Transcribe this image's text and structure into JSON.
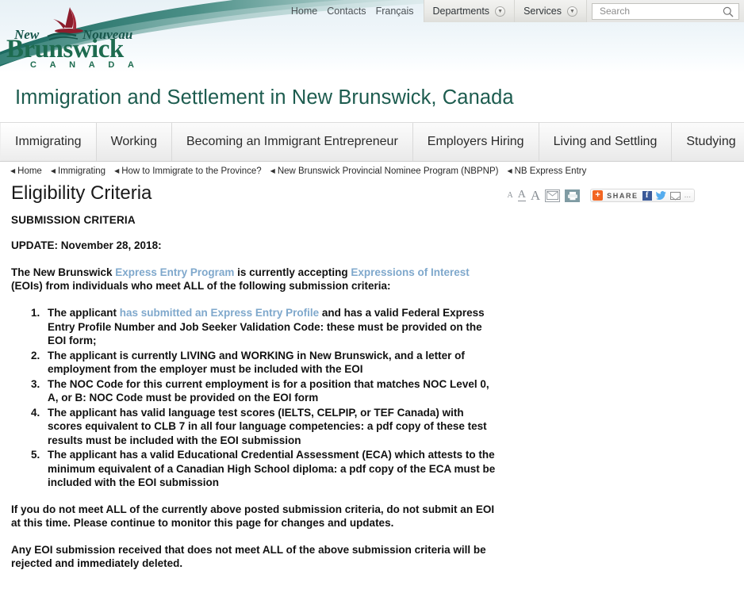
{
  "header": {
    "logo": {
      "line1_left": "New",
      "line1_right": "Nouveau",
      "wordmark": "Brunswick",
      "country": "C A N A D A"
    },
    "topnav": {
      "links": [
        {
          "label": "Home",
          "name": "topnav-home"
        },
        {
          "label": "Contacts",
          "name": "topnav-contacts"
        },
        {
          "label": "Français",
          "name": "topnav-francais"
        }
      ],
      "menus": [
        {
          "label": "Departments",
          "name": "topnav-departments"
        },
        {
          "label": "Services",
          "name": "topnav-services"
        }
      ],
      "search": {
        "placeholder": "Search",
        "value": "",
        "icon": "search-icon"
      }
    }
  },
  "banner": {
    "title": "Immigration and Settlement in New Brunswick, Canada",
    "color": "#1d5c4f"
  },
  "tabs": [
    {
      "label": "Immigrating",
      "active": true
    },
    {
      "label": "Working",
      "active": false
    },
    {
      "label": "Becoming an Immigrant Entrepreneur",
      "active": false
    },
    {
      "label": "Employers Hiring",
      "active": false
    },
    {
      "label": "Living and Settling",
      "active": false
    },
    {
      "label": "Studying",
      "active": false
    }
  ],
  "breadcrumb": [
    {
      "label": "Home"
    },
    {
      "label": "Immigrating"
    },
    {
      "label": "How to Immigrate to the Province?"
    },
    {
      "label": "New Brunswick Provincial Nominee Program (NBPNP)"
    },
    {
      "label": "NB Express Entry"
    }
  ],
  "toolbar": {
    "font_small": "A",
    "font_medium": "A",
    "font_large": "A",
    "email_icon": "envelope-icon",
    "print_icon": "printer-icon",
    "share": {
      "plus": "+",
      "label": "SHARE",
      "facebook": "f",
      "twitter": "twitter-bird-icon",
      "email": "envelope-icon",
      "more": "..."
    }
  },
  "page": {
    "title": "Eligibility Criteria",
    "section_heading": "SUBMISSION CRITERIA",
    "update_line": "UPDATE: November 28, 2018:",
    "intro": {
      "part1": "The New Brunswick ",
      "link1": "Express Entry Program",
      "part2": " is currently accepting ",
      "link2": "Expressions of Interest",
      "part3": " (EOIs) from individuals who meet ALL of the following submission criteria:"
    },
    "criteria": [
      {
        "pre": "The applicant ",
        "link": "has submitted an Express Entry Profile",
        "post": " and has a valid Federal Express Entry Profile Number and Job Seeker Validation Code: these must be provided on the EOI form;"
      },
      {
        "pre": "The applicant is currently LIVING and WORKING in New Brunswick, and a letter of employment from the employer must be included with the EOI",
        "link": "",
        "post": ""
      },
      {
        "pre": "The NOC Code for this current employment is for a position that matches NOC Level 0, A, or B: NOC Code must be provided on the EOI form",
        "link": "",
        "post": ""
      },
      {
        "pre": "The applicant has valid language test scores (IELTS, CELPIP, or TEF Canada) with scores equivalent to CLB 7 in all four language competencies:  a pdf copy of these test results must be included with the EOI submission",
        "link": "",
        "post": ""
      },
      {
        "pre": "The applicant has a valid Educational Credential Assessment (ECA) which attests to the minimum equivalent of a Canadian High School diploma: a pdf copy of the ECA must be included with the EOI submission",
        "link": "",
        "post": ""
      }
    ],
    "closing1": "If you do not meet ALL of the currently above posted submission criteria, do not submit an EOI at this time. Please continue to monitor this page for changes and updates.",
    "closing2": "Any EOI submission received that does not meet ALL of the above submission criteria will be rejected and immediately deleted."
  }
}
